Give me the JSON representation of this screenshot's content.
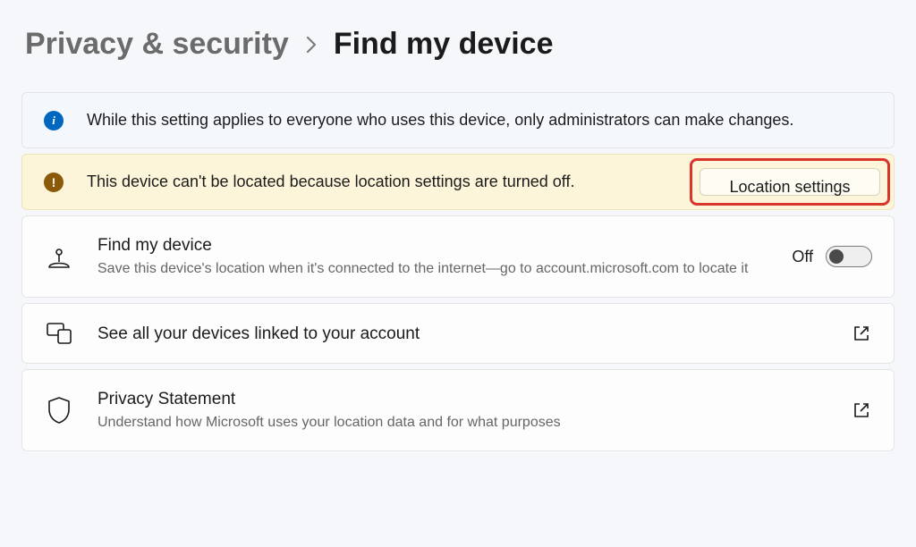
{
  "breadcrumb": {
    "parent": "Privacy & security",
    "current": "Find my device"
  },
  "info_banner": {
    "text": "While this setting applies to everyone who uses this device, only administrators can make changes."
  },
  "warn_banner": {
    "text": "This device can't be located because location settings are turned off.",
    "button_label": "Location settings"
  },
  "find_my_device": {
    "title": "Find my device",
    "desc": "Save this device's location when it's connected to the internet—go to account.microsoft.com to locate it",
    "toggle_state_label": "Off",
    "toggle_on": false
  },
  "linked_devices": {
    "title": "See all your devices linked to your account"
  },
  "privacy_statement": {
    "title": "Privacy Statement",
    "desc": "Understand how Microsoft uses your location data and for what purposes"
  }
}
